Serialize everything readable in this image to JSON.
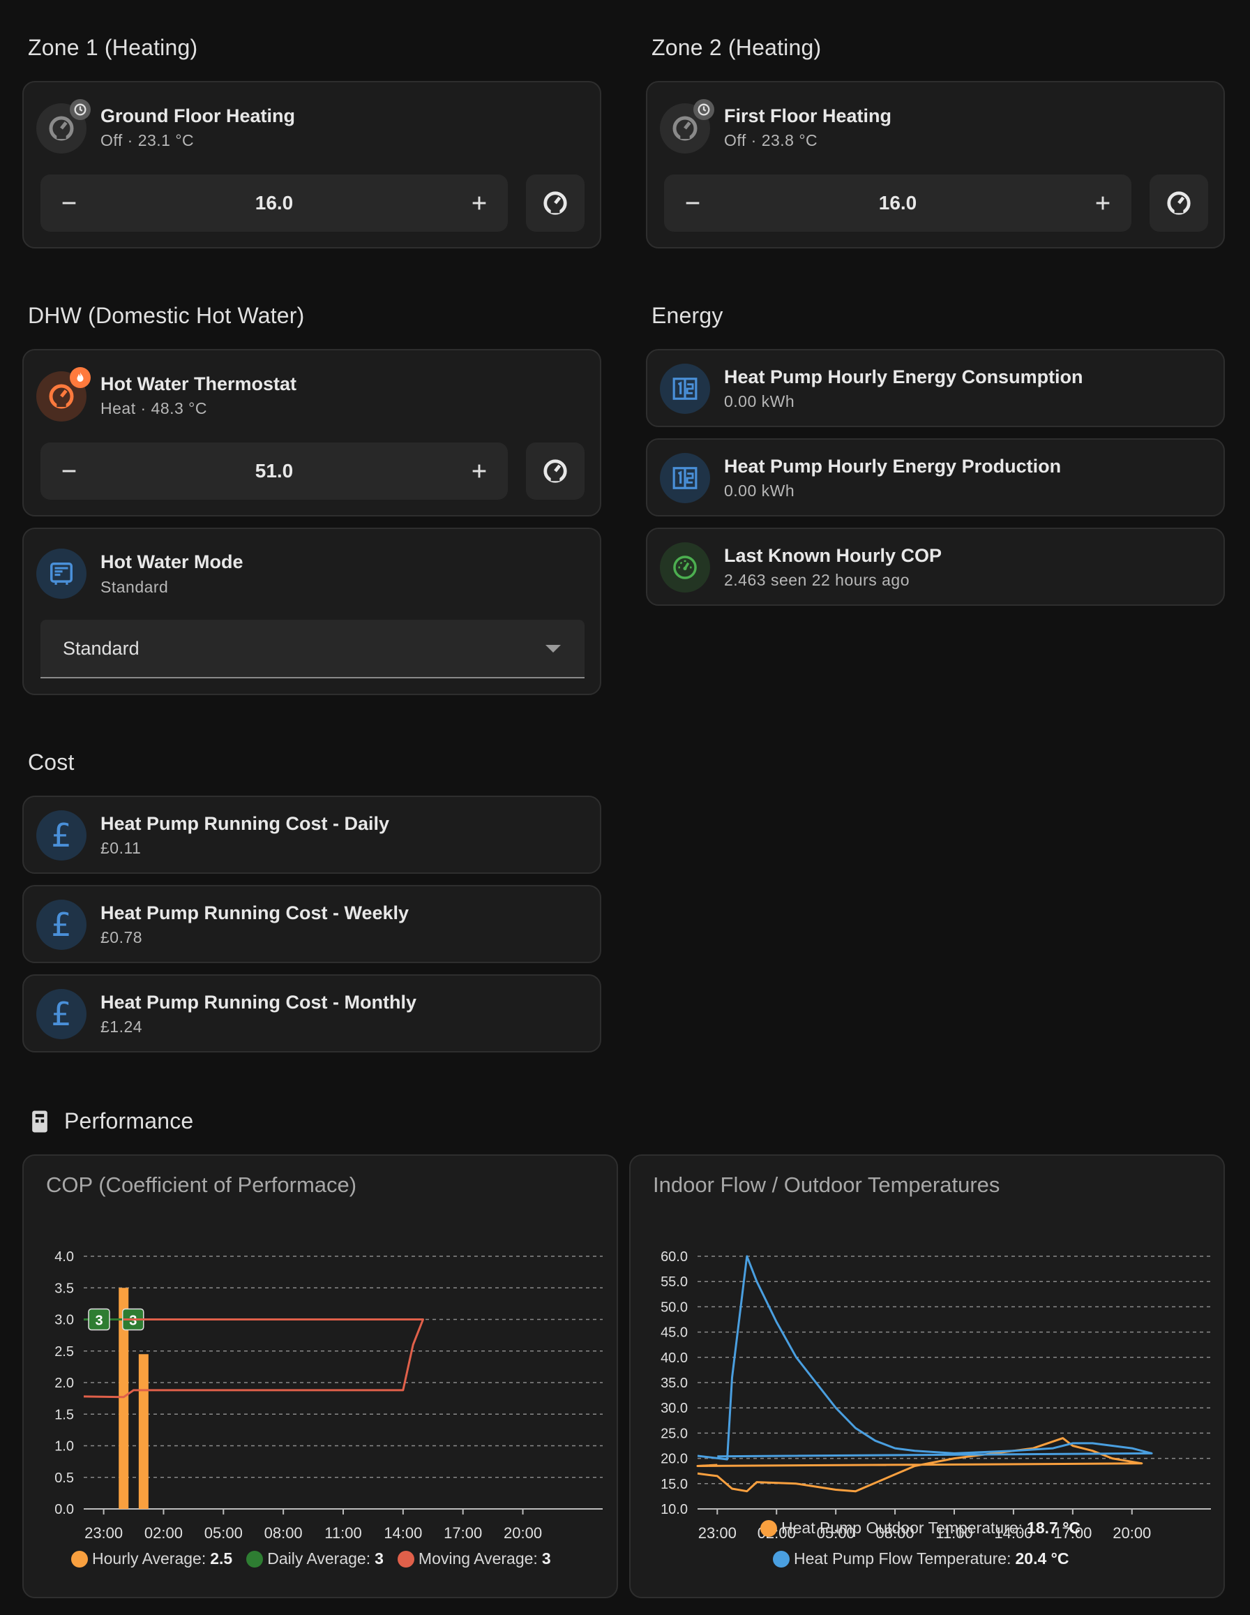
{
  "zone1": {
    "title": "Zone 1 (Heating)",
    "tile": {
      "name": "Ground Floor Heating",
      "state": "Off · 23.1 °C",
      "setpoint": "16.0",
      "icon": "thermostat-icon",
      "badge": "clock-badge-icon"
    }
  },
  "zone2": {
    "title": "Zone 2 (Heating)",
    "tile": {
      "name": "First Floor Heating",
      "state": "Off · 23.8 °C",
      "setpoint": "16.0",
      "icon": "thermostat-icon",
      "badge": "clock-badge-icon"
    }
  },
  "dhw": {
    "title": "DHW (Domestic Hot Water)",
    "thermostat": {
      "name": "Hot Water Thermostat",
      "state": "Heat · 48.3 °C",
      "setpoint": "51.0",
      "icon": "thermostat-icon",
      "badge": "flame-badge-icon"
    },
    "mode": {
      "name": "Hot Water Mode",
      "state": "Standard",
      "selected": "Standard",
      "icon": "water-heater-icon"
    }
  },
  "energy": {
    "title": "Energy",
    "items": [
      {
        "name": "Heat Pump Hourly Energy Consumption",
        "state": "0.00 kWh",
        "icon": "counter-icon"
      },
      {
        "name": "Heat Pump Hourly Energy Production",
        "state": "0.00 kWh",
        "icon": "counter-icon"
      },
      {
        "name": "Last Known Hourly COP",
        "state": "2.463 seen 22 hours ago",
        "icon": "gauge-icon"
      }
    ]
  },
  "cost": {
    "title": "Cost",
    "items": [
      {
        "name": "Heat Pump Running Cost - Daily",
        "state": "£0.11",
        "icon": "currency-gbp-icon"
      },
      {
        "name": "Heat Pump Running Cost - Weekly",
        "state": "£0.78",
        "icon": "currency-gbp-icon"
      },
      {
        "name": "Heat Pump Running Cost - Monthly",
        "state": "£1.24",
        "icon": "currency-gbp-icon"
      }
    ]
  },
  "performance": {
    "title": "Performance",
    "icon": "heat-pump-icon"
  },
  "colors": {
    "orange": "#f9a03f",
    "green": "#2e7d32",
    "red": "#e0604a",
    "blue": "#4a9fe0",
    "icon_blue": "#4a90d9",
    "icon_green": "#4caf50",
    "icon_orange": "#ff7a3d"
  },
  "chart_data": [
    {
      "type": "bar",
      "title": "COP (Coefficient of Performace)",
      "x_ticks": [
        "23:00",
        "02:00",
        "05:00",
        "08:00",
        "11:00",
        "14:00",
        "17:00",
        "20:00"
      ],
      "y_ticks": [
        "0.0",
        "0.5",
        "1.0",
        "1.5",
        "2.0",
        "2.5",
        "3.0",
        "3.5",
        "4.0"
      ],
      "ylim": [
        0,
        4
      ],
      "grid": true,
      "legend_placement": "bottom",
      "series": [
        {
          "name": "Hourly Average",
          "legend_value": "2.5",
          "kind": "bar",
          "points": [
            [
              "00:00",
              3.5
            ],
            [
              "01:00",
              2.45
            ]
          ]
        },
        {
          "name": "Daily Average",
          "legend_value": "3",
          "kind": "line",
          "points": [
            [
              "22:00",
              3.0
            ],
            [
              "23:59",
              3.0
            ]
          ],
          "end_labels": [
            "3",
            "3"
          ]
        },
        {
          "name": "Moving Average",
          "legend_value": "3",
          "kind": "line",
          "points": [
            [
              "22:00",
              1.78
            ],
            [
              "00:00",
              1.77
            ],
            [
              "00:30",
              1.88
            ],
            [
              "14:00",
              1.88
            ],
            [
              "14:30",
              2.6
            ],
            [
              "15:00",
              3.0
            ],
            [
              "23:59",
              3.0
            ]
          ]
        }
      ]
    },
    {
      "type": "line",
      "title": "Indoor Flow / Outdoor Temperatures",
      "x_ticks": [
        "23:00",
        "02:00",
        "05:00",
        "08:00",
        "11:00",
        "14:00",
        "17:00",
        "20:00"
      ],
      "y_ticks": [
        "10.0",
        "15.0",
        "20.0",
        "25.0",
        "30.0",
        "35.0",
        "40.0",
        "45.0",
        "50.0",
        "55.0",
        "60.0"
      ],
      "ylim": [
        10,
        60
      ],
      "grid": true,
      "legend_placement": "bottom",
      "series": [
        {
          "name": "Heat Pump Outdoor Temperature",
          "legend_value": "18.7 °C",
          "points": [
            [
              "22:00",
              17.0
            ],
            [
              "23:00",
              16.5
            ],
            [
              "23:45",
              14.0
            ],
            [
              "00:30",
              13.5
            ],
            [
              "01:00",
              15.3
            ],
            [
              "03:00",
              15.0
            ],
            [
              "05:00",
              13.8
            ],
            [
              "06:00",
              13.5
            ],
            [
              "07:30",
              16.0
            ],
            [
              "09:00",
              18.5
            ],
            [
              "11:00",
              20.0
            ],
            [
              "13:00",
              21.0
            ],
            [
              "15:00",
              22.0
            ],
            [
              "16:30",
              24.0
            ],
            [
              "17:00",
              22.5
            ],
            [
              "18:00",
              21.5
            ],
            [
              "19:00",
              20.0
            ],
            [
              "20:30",
              19.0
            ],
            [
              "22:00",
              18.5
            ],
            [
              "23:00",
              18.7
            ]
          ]
        },
        {
          "name": "Heat Pump Flow Temperature",
          "legend_value": "20.4 °C",
          "points": [
            [
              "22:00",
              20.5
            ],
            [
              "23:30",
              19.8
            ],
            [
              "23:45",
              36.0
            ],
            [
              "00:30",
              60.0
            ],
            [
              "01:00",
              55.0
            ],
            [
              "02:00",
              47.0
            ],
            [
              "03:00",
              40.0
            ],
            [
              "04:00",
              35.0
            ],
            [
              "05:00",
              30.0
            ],
            [
              "06:00",
              26.0
            ],
            [
              "07:00",
              23.5
            ],
            [
              "08:00",
              22.0
            ],
            [
              "09:00",
              21.5
            ],
            [
              "11:00",
              21.0
            ],
            [
              "14:00",
              21.5
            ],
            [
              "16:00",
              22.0
            ],
            [
              "17:00",
              23.0
            ],
            [
              "18:00",
              23.0
            ],
            [
              "20:00",
              22.0
            ],
            [
              "21:00",
              21.0
            ],
            [
              "23:00",
              20.4
            ]
          ]
        }
      ]
    }
  ]
}
